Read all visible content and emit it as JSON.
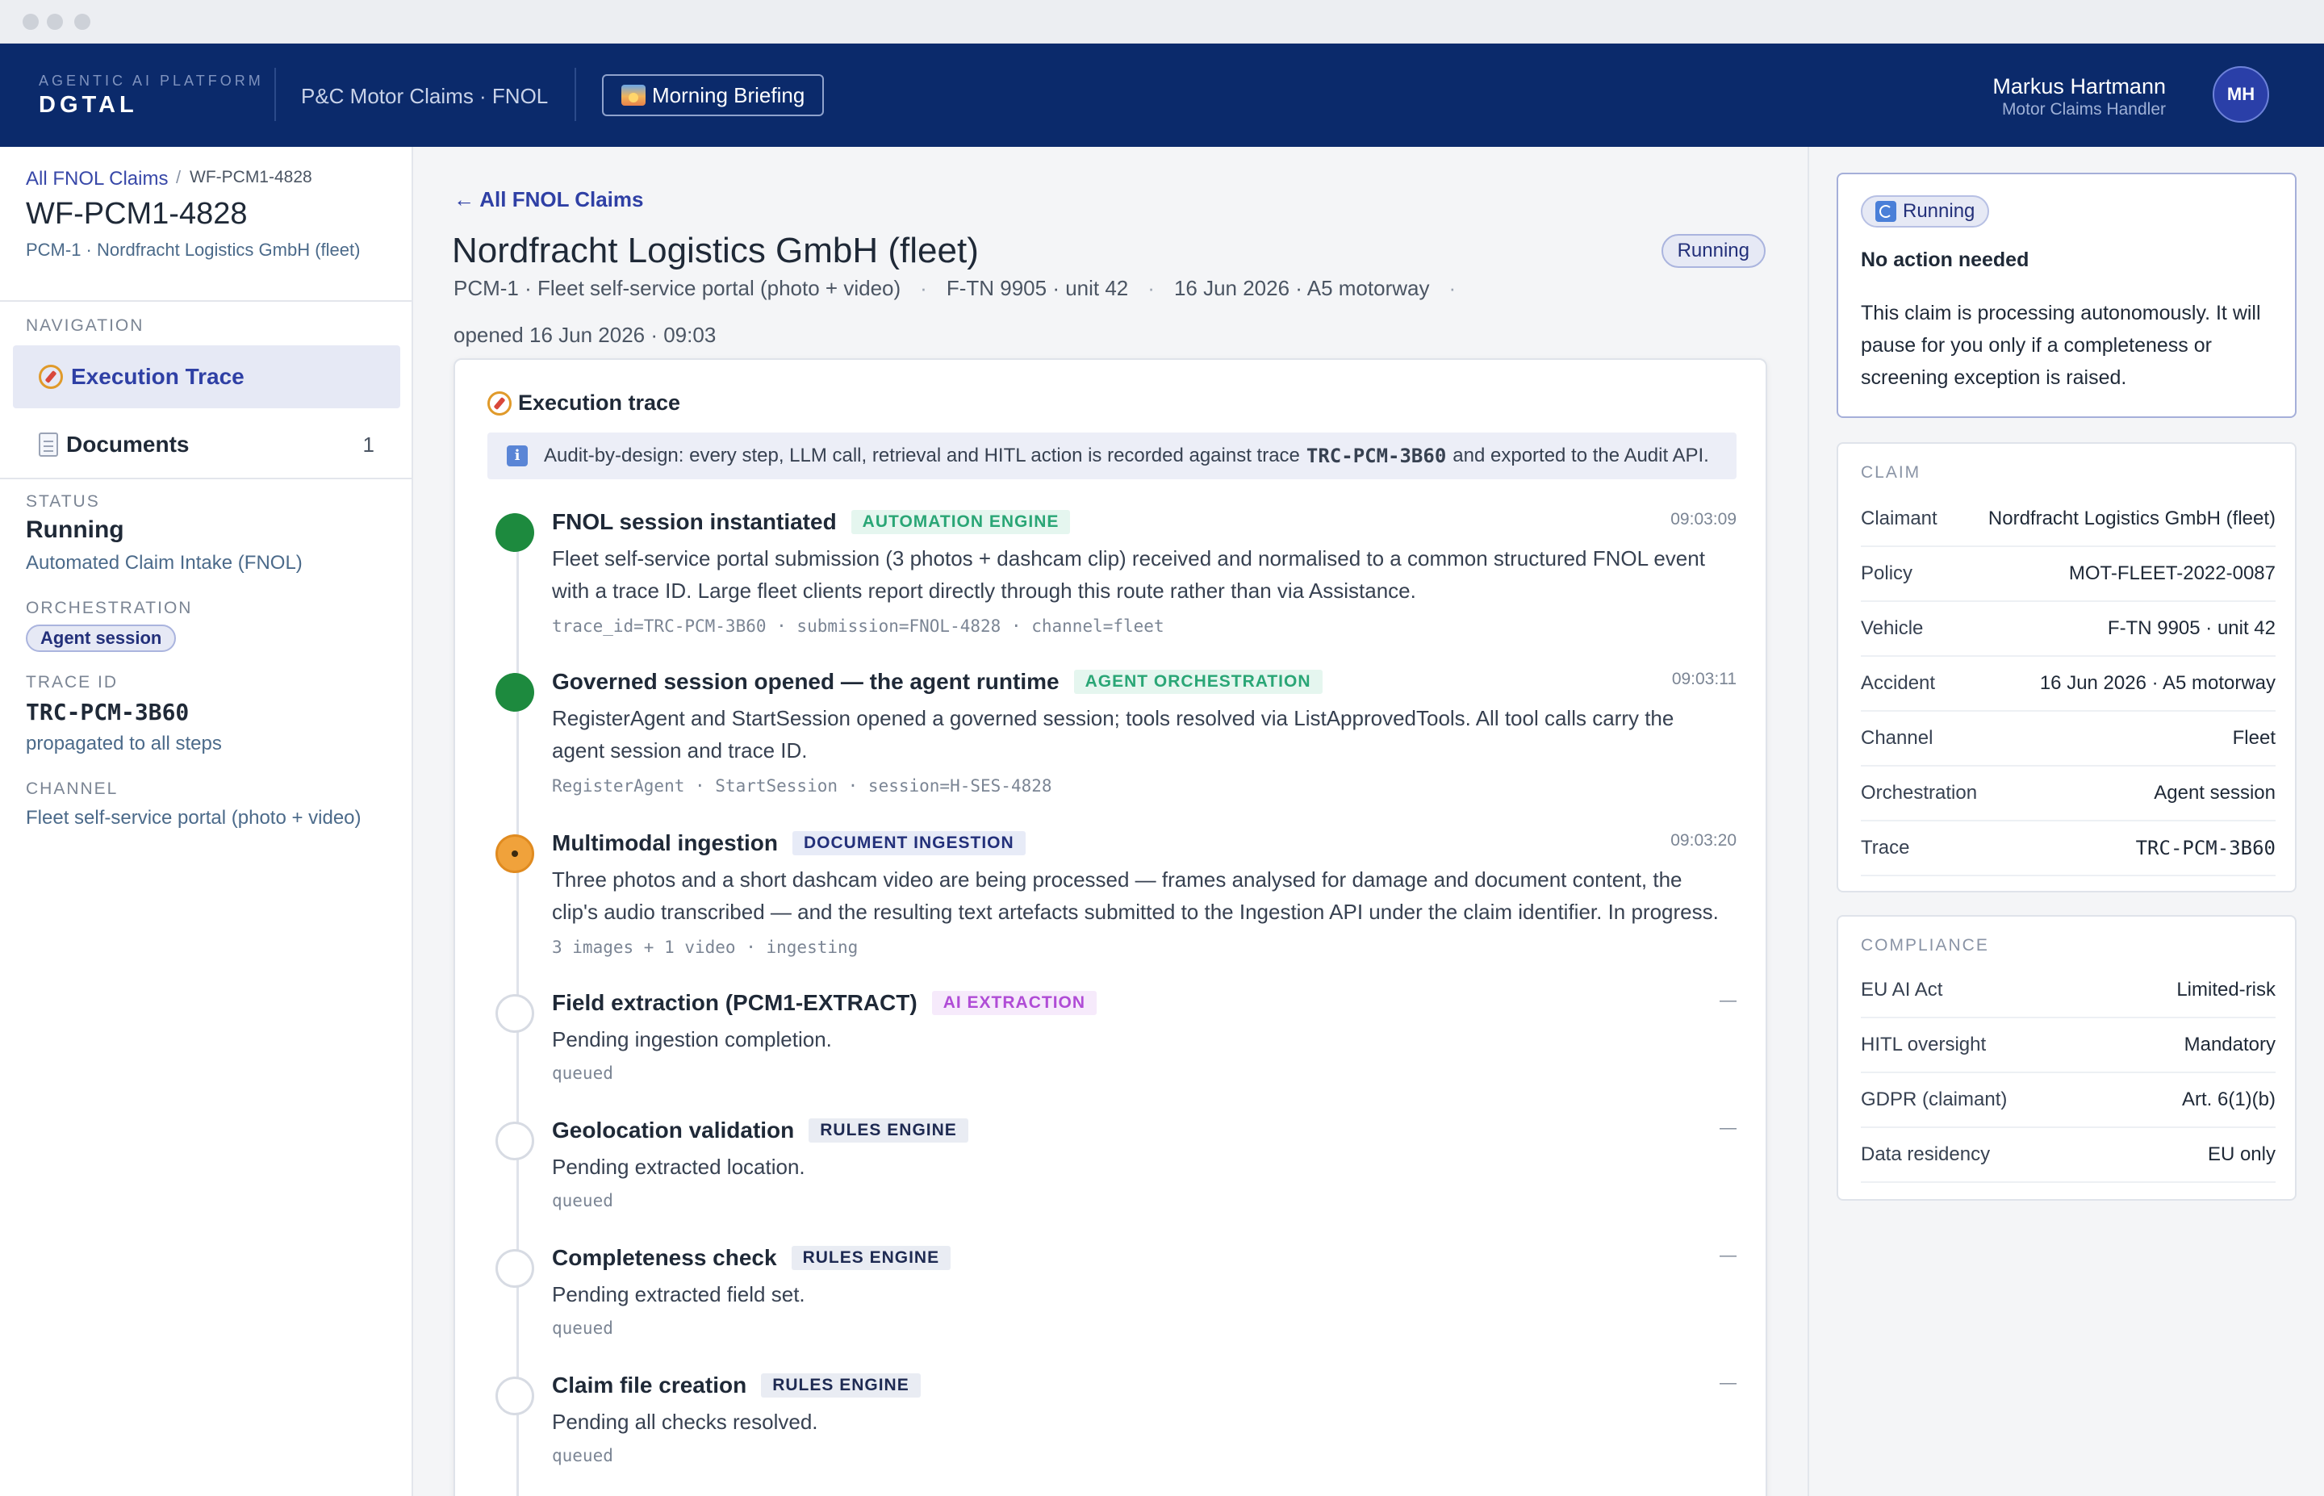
{
  "header": {
    "platform_label": "AGENTIC AI PLATFORM",
    "brand": "DGTAL",
    "product": "P&C Motor Claims · FNOL",
    "briefing_button": "Morning Briefing",
    "user_name": "Markus Hartmann",
    "user_role": "Motor Claims Handler",
    "user_initials": "MH"
  },
  "sidebar": {
    "breadcrumb_link": "All FNOL Claims",
    "breadcrumb_sep": "/",
    "breadcrumb_current": "WF-PCM1-4828",
    "claim_id": "WF-PCM1-4828",
    "claim_sub": "PCM-1 · Nordfracht Logistics GmbH (fleet)",
    "nav_label": "NAVIGATION",
    "nav_items": [
      {
        "label": "Execution Trace",
        "icon": "compass-icon",
        "active": true
      },
      {
        "label": "Documents",
        "icon": "document-icon",
        "count": "1"
      }
    ],
    "status_label": "STATUS",
    "status_value": "Running",
    "status_sub": "Automated Claim Intake (FNOL)",
    "orchestration_label": "ORCHESTRATION",
    "orchestration_value": "Agent session",
    "trace_label": "TRACE ID",
    "trace_value": "TRC-PCM-3B60",
    "trace_sub": "propagated to all steps",
    "channel_label": "CHANNEL",
    "channel_value": "Fleet self-service portal (photo + video)"
  },
  "main": {
    "back_link": "← All FNOL Claims",
    "entity": "Nordfracht Logistics GmbH (fleet)",
    "status_badge": "Running",
    "meta": [
      "PCM-1 · Fleet self-service portal (photo + video)",
      "F-TN 9905 · unit 42",
      "16 Jun 2026 · A5 motorway"
    ],
    "meta_bullet": "·",
    "opened": "opened 16 Jun 2026 · 09:03",
    "trace_title": "Execution trace",
    "audit": {
      "prefix": "Audit-by-design: every step, LLM call, retrieval and HITL action is recorded against trace",
      "trace": "TRC-PCM-3B60",
      "suffix": "and exported to the Audit API."
    },
    "steps": [
      {
        "title": "FNOL session instantiated",
        "tag": "AUTOMATION ENGINE",
        "time": "09:03:09",
        "status": "done",
        "desc": "Fleet self-service portal submission (3 photos + dashcam clip) received and normalised to a common structured FNOL event with a trace ID. Large fleet clients report directly through this route rather than via Assistance.",
        "code": "trace_id=TRC-PCM-3B60 · submission=FNOL-4828 · channel=fleet"
      },
      {
        "title": "Governed session opened — the agent runtime",
        "tag": "AGENT ORCHESTRATION",
        "time": "09:03:11",
        "status": "done",
        "desc": "RegisterAgent and StartSession opened a governed session; tools resolved via ListApprovedTools. All tool calls carry the agent session and trace ID.",
        "code": "RegisterAgent · StartSession · session=H-SES-4828"
      },
      {
        "title": "Multimodal ingestion",
        "tag": "DOCUMENT INGESTION",
        "time": "09:03:20",
        "status": "in-progress",
        "desc": "Three photos and a short dashcam video are being processed — frames analysed for damage and document content, the clip's audio transcribed — and the resulting text artefacts submitted to the Ingestion API under the claim identifier. In progress.",
        "code": "3 images + 1 video · ingesting"
      },
      {
        "title": "Field extraction (PCM1-EXTRACT)",
        "tag": "AI EXTRACTION",
        "time": "—",
        "status": "queued",
        "desc": "Pending ingestion completion.",
        "code": "queued"
      },
      {
        "title": "Geolocation validation",
        "tag": "RULES ENGINE",
        "time": "—",
        "status": "queued",
        "desc": "Pending extracted location.",
        "code": "queued"
      },
      {
        "title": "Completeness check",
        "tag": "RULES ENGINE",
        "time": "—",
        "status": "queued",
        "desc": "Pending extracted field set.",
        "code": "queued"
      },
      {
        "title": "Claim file creation",
        "tag": "RULES ENGINE",
        "time": "—",
        "status": "queued",
        "desc": "Pending all checks resolved.",
        "code": "queued"
      }
    ]
  },
  "right": {
    "status_pill": "Running",
    "action_title": "No action needed",
    "action_body": "This claim is processing autonomously. It will pause for you only if a completeness or screening exception is raised.",
    "claim_label": "CLAIM",
    "claim_rows": [
      {
        "k": "Claimant",
        "v": "Nordfracht Logistics GmbH (fleet)"
      },
      {
        "k": "Policy",
        "v": "MOT-FLEET-2022-0087"
      },
      {
        "k": "Vehicle",
        "v": "F-TN 9905 · unit 42"
      },
      {
        "k": "Accident",
        "v": "16 Jun 2026 · A5 motorway"
      },
      {
        "k": "Channel",
        "v": "Fleet"
      },
      {
        "k": "Orchestration",
        "v": "Agent session"
      },
      {
        "k": "Trace",
        "v": "TRC-PCM-3B60"
      }
    ],
    "compliance_label": "COMPLIANCE",
    "compliance_rows": [
      {
        "k": "EU AI Act",
        "v": "Limited-risk"
      },
      {
        "k": "HITL oversight",
        "v": "Mandatory"
      },
      {
        "k": "GDPR (claimant)",
        "v": "Art. 6(1)(b)"
      },
      {
        "k": "Data residency",
        "v": "EU only"
      }
    ]
  },
  "colors": {
    "navy": "#0b2a6b",
    "accent": "#2f40a5",
    "done": "#1d8a3e",
    "in_progress": "#f0a23b",
    "tag_automation_bg": "#e5f6ef",
    "tag_automation_fg": "#2aa676",
    "tag_agent_bg": "#e5f6ef",
    "tag_agent_fg": "#2aa676",
    "tag_document_bg": "#e7ebf7",
    "tag_document_fg": "#23307a",
    "tag_ai_bg": "#f6eafb",
    "tag_ai_fg": "#b04cd6",
    "tag_rules_bg": "#e9ecf3",
    "tag_rules_fg": "#1e2a52"
  }
}
